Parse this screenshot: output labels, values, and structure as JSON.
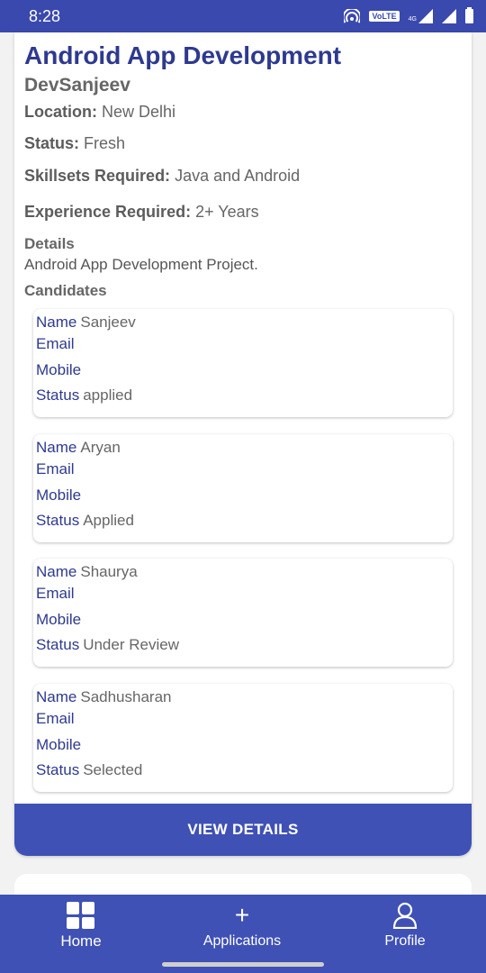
{
  "status_bar": {
    "time": "8:28",
    "volte": "VoLTE",
    "network": "4G"
  },
  "job": {
    "title": "Android App Development",
    "company": "DevSanjeev",
    "location_label": "Location:",
    "location": "New Delhi",
    "status_label": "Status:",
    "status": "Fresh",
    "skills_label": "Skillsets Required:",
    "skills": "Java and Android",
    "experience_label": "Experience Required:",
    "experience": "2+ Years",
    "details_label": "Details",
    "details": "Android App Development Project.",
    "candidates_label": "Candidates"
  },
  "candidate_labels": {
    "name": "Name",
    "email": "Email",
    "mobile": "Mobile",
    "status": "Status"
  },
  "candidates": [
    {
      "name": "Sanjeev",
      "status": "applied"
    },
    {
      "name": "Aryan",
      "status": "Applied"
    },
    {
      "name": "Shaurya",
      "status": "Under Review"
    },
    {
      "name": "Sadhusharan",
      "status": "Selected"
    }
  ],
  "view_details_label": "VIEW DETAILS",
  "nav": {
    "home": "Home",
    "applications": "Applications",
    "profile": "Profile"
  },
  "colors": {
    "primary": "#3f51b5",
    "title": "#2e3a8f"
  }
}
